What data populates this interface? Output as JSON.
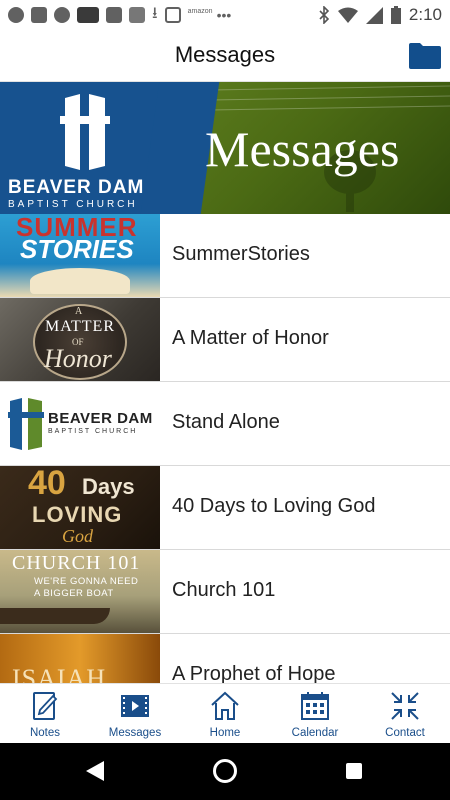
{
  "status": {
    "time": "2:10",
    "notification_icons": [
      "spotify-icon",
      "facebook-icon",
      "slack-icon",
      "news-icon",
      "clipboard-icon",
      "app-icon",
      "download-icon",
      "mail-icon",
      "amazon-icon",
      "more-icon"
    ],
    "amazon_text": "amazon",
    "right_icons": [
      "bluetooth-icon",
      "wifi-icon",
      "signal-icon",
      "battery-icon"
    ]
  },
  "app_bar": {
    "title": "Messages"
  },
  "banner": {
    "church_name": "BEAVER DAM",
    "church_sub": "BAPTIST CHURCH",
    "title": "Messages"
  },
  "series": [
    {
      "label": "SummerStories",
      "thumb_title_1": "SUMMER",
      "thumb_title_2": "STORIES"
    },
    {
      "label": "A Matter of Honor",
      "thumb_title_1": "A",
      "thumb_title_2": "MATTER",
      "thumb_title_3": "OF",
      "thumb_title_4": "Honor"
    },
    {
      "label": "Stand Alone",
      "thumb_title_1": "BEAVER DAM",
      "thumb_title_2": "BAPTIST CHURCH"
    },
    {
      "label": "40 Days to Loving God",
      "thumb_title_1": "40",
      "thumb_title_2": "Days",
      "thumb_title_3": "LOVING",
      "thumb_title_4": "God"
    },
    {
      "label": "Church 101",
      "thumb_title_1": "CHURCH 101",
      "thumb_title_2": "WE'RE GONNA NEED",
      "thumb_title_3": "A BIGGER BOAT"
    },
    {
      "label": "A Prophet of Hope",
      "thumb_title_1": "ISAIAH"
    }
  ],
  "tabs": [
    {
      "label": "Notes",
      "icon": "notes-icon"
    },
    {
      "label": "Messages",
      "icon": "video-icon"
    },
    {
      "label": "Home",
      "icon": "home-icon"
    },
    {
      "label": "Calendar",
      "icon": "calendar-icon"
    },
    {
      "label": "Contact",
      "icon": "contact-icon"
    }
  ],
  "colors": {
    "brand_blue": "#17528f",
    "tab_blue": "#1a4e8a"
  }
}
